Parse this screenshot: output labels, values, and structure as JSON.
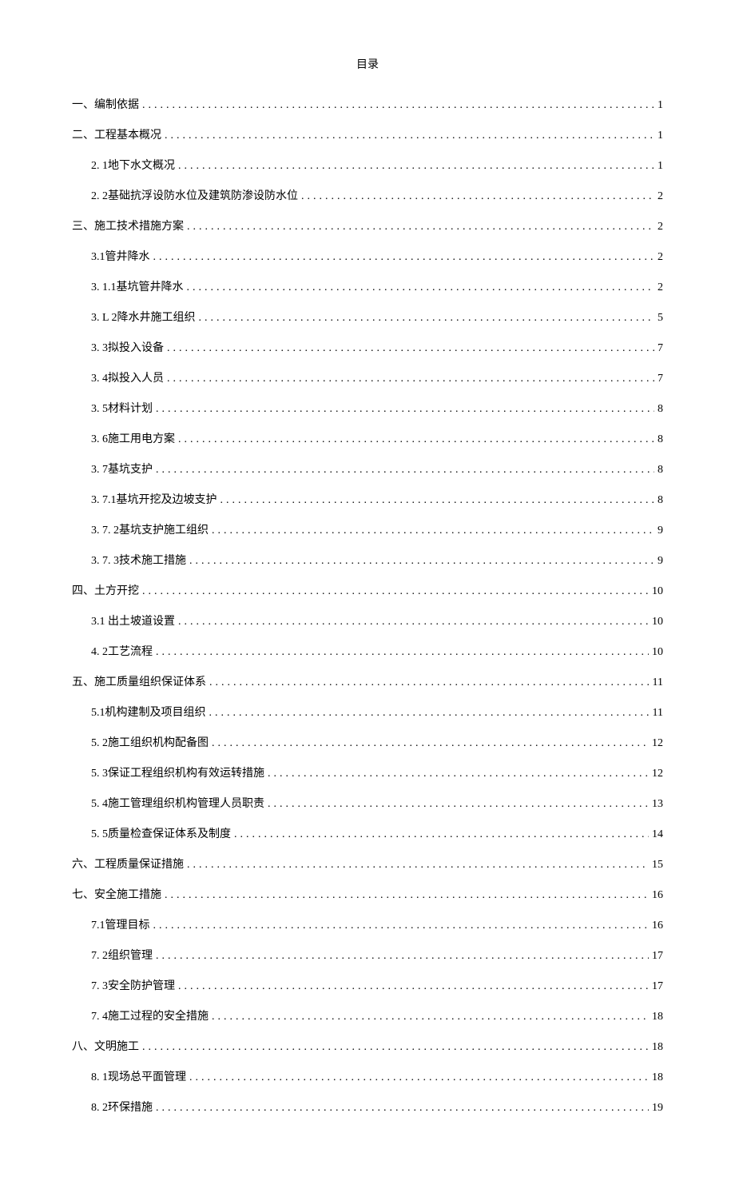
{
  "title": "目录",
  "entries": [
    {
      "level": 1,
      "label": "一、编制依据",
      "page": "1"
    },
    {
      "level": 1,
      "label": "二、工程基本概况",
      "page": "1"
    },
    {
      "level": 2,
      "label": "2. 1地下水文概况",
      "page": "1"
    },
    {
      "level": 2,
      "label": "2. 2基础抗浮设防水位及建筑防渗设防水位",
      "page": "2"
    },
    {
      "level": 1,
      "label": "三、施工技术措施方案",
      "page": "2"
    },
    {
      "level": 2,
      "label": "3.1管井降水",
      "page": "2"
    },
    {
      "level": 2,
      "label": "3. 1.1基坑管井降水",
      "page": "2"
    },
    {
      "level": 2,
      "label": "3. L 2降水井施工组织",
      "page": "5"
    },
    {
      "level": 2,
      "label": "3. 3拟投入设备",
      "page": "7"
    },
    {
      "level": 2,
      "label": "3. 4拟投入人员",
      "page": "7"
    },
    {
      "level": 2,
      "label": "3. 5材料计划",
      "page": "8"
    },
    {
      "level": 2,
      "label": "3. 6施工用电方案",
      "page": "8"
    },
    {
      "level": 2,
      "label": "3. 7基坑支护",
      "page": "8"
    },
    {
      "level": 2,
      "label": "3. 7.1基坑开挖及边坡支护",
      "page": "8"
    },
    {
      "level": 2,
      "label": "3. 7. 2基坑支护施工组织",
      "page": "9"
    },
    {
      "level": 2,
      "label": "3. 7. 3技术施工措施",
      "page": "9"
    },
    {
      "level": 1,
      "label": "四、土方开挖",
      "page": "10"
    },
    {
      "level": 2,
      "label": "3.1  出土坡道设置",
      "page": "10"
    },
    {
      "level": 2,
      "label": "4. 2工艺流程",
      "page": "10"
    },
    {
      "level": 1,
      "label": "五、施工质量组织保证体系",
      "page": "11"
    },
    {
      "level": 2,
      "label": "5.1机构建制及项目组织",
      "page": "11"
    },
    {
      "level": 2,
      "label": "5. 2施工组织机构配备图",
      "page": "12"
    },
    {
      "level": 2,
      "label": "5. 3保证工程组织机构有效运转措施",
      "page": "12"
    },
    {
      "level": 2,
      "label": "5. 4施工管理组织机构管理人员职责",
      "page": "13"
    },
    {
      "level": 2,
      "label": "5. 5质量检查保证体系及制度",
      "page": "14"
    },
    {
      "level": 1,
      "label": "六、工程质量保证措施",
      "page": "15"
    },
    {
      "level": 1,
      "label": "七、安全施工措施",
      "page": "16"
    },
    {
      "level": 2,
      "label": "7.1管理目标",
      "page": "16"
    },
    {
      "level": 2,
      "label": "7. 2组织管理",
      "page": "17"
    },
    {
      "level": 2,
      "label": "7. 3安全防护管理",
      "page": "17"
    },
    {
      "level": 2,
      "label": "7. 4施工过程的安全措施",
      "page": "18"
    },
    {
      "level": 1,
      "label": "八、文明施工",
      "page": "18"
    },
    {
      "level": 2,
      "label": "8. 1现场总平面管理",
      "page": "18"
    },
    {
      "level": 2,
      "label": "8. 2环保措施",
      "page": "19"
    }
  ]
}
